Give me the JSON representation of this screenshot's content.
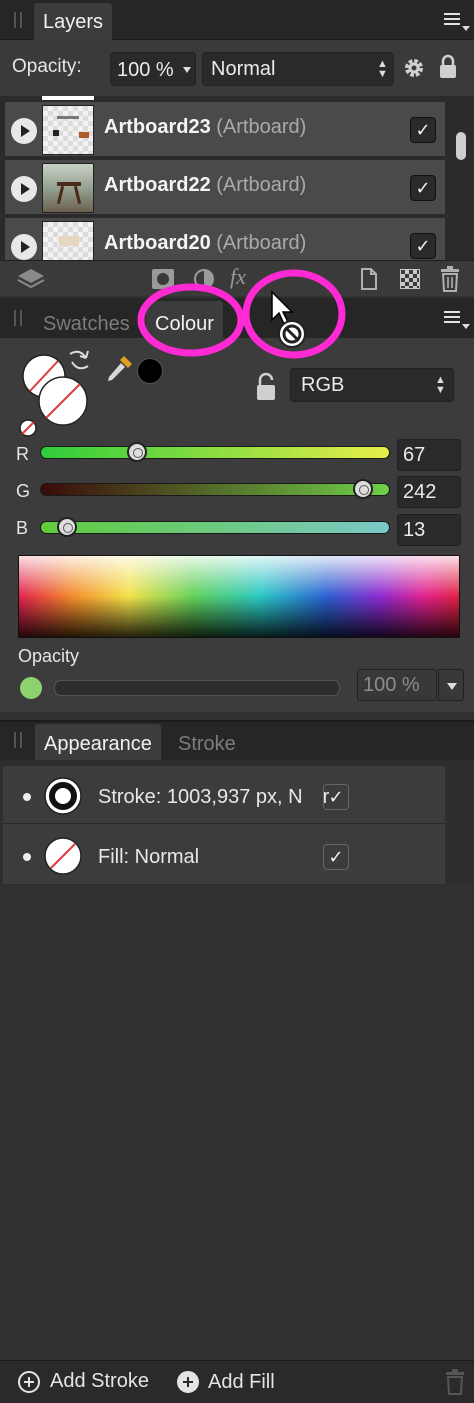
{
  "layers_panel": {
    "tab_label": "Layers",
    "opacity_label": "Opacity:",
    "opacity_value": "100 %",
    "blend_mode": "Normal",
    "rows": [
      {
        "name": "Artboard23",
        "type": "(Artboard)",
        "visible_check": "✓"
      },
      {
        "name": "Artboard22",
        "type": "(Artboard)",
        "visible_check": "✓"
      },
      {
        "name": "Artboard20",
        "type": "(Artboard)",
        "visible_check": "✓"
      }
    ],
    "toolbar_icons": [
      "layers-icon",
      "mask-icon",
      "adjustment-icon",
      "fx-icon",
      "new-page-icon",
      "checker-icon",
      "trash-icon"
    ],
    "fx_glyph": "fx"
  },
  "colour_panel": {
    "tabs": {
      "swatches": "Swatches",
      "colour": "Colour"
    },
    "colour_model": "RGB",
    "sliders": [
      {
        "label": "R",
        "value": "67",
        "fraction": 0.263
      },
      {
        "label": "G",
        "value": "242",
        "fraction": 0.949
      },
      {
        "label": "B",
        "value": "13",
        "fraction": 0.051
      }
    ],
    "opacity_label": "Opacity",
    "opacity_value": "100 %",
    "colors": {
      "current": "#43f20d",
      "swatch_dot": "#8fd06f",
      "highlight": "#ff2ad4"
    }
  },
  "appearance_panel": {
    "tabs": {
      "appearance": "Appearance",
      "stroke": "Stroke"
    },
    "rows": [
      {
        "text": "Stroke: 1003,937 px, N",
        "text_tail": "r",
        "check": "✓"
      },
      {
        "text": "Fill: Normal",
        "check": "✓"
      }
    ],
    "add_stroke": "Add Stroke",
    "add_fill": "Add Fill"
  }
}
